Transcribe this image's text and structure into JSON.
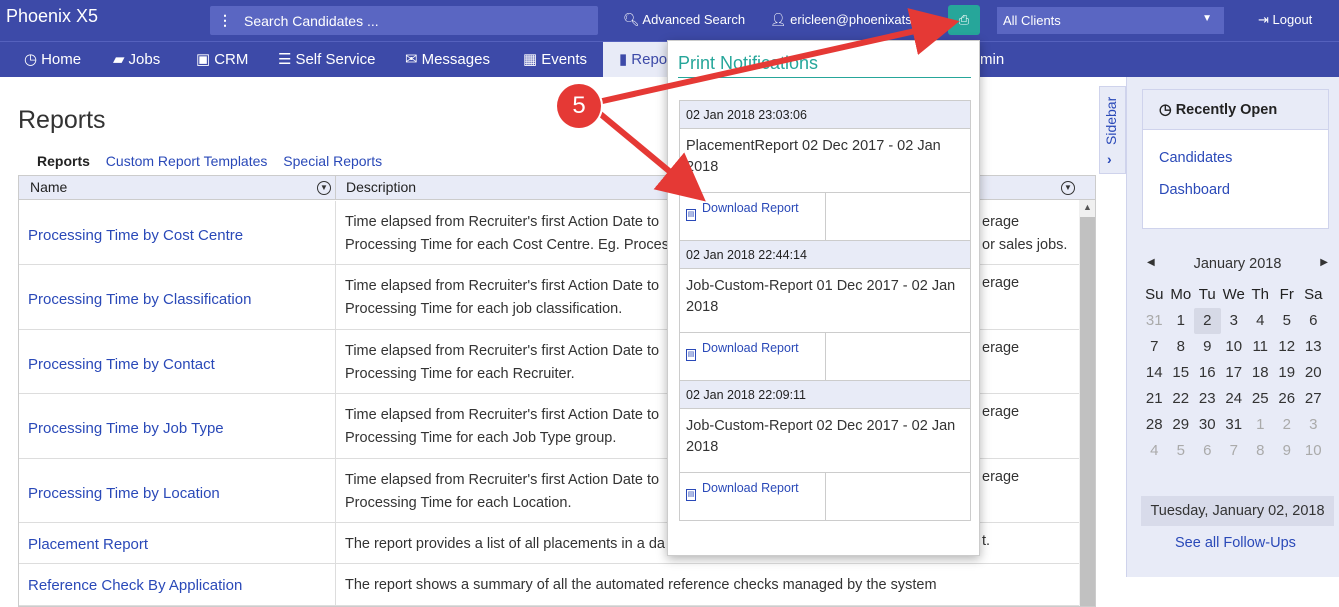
{
  "app": {
    "brand": "Phoenix X5",
    "search_placeholder": "Search Candidates ...",
    "advanced_search": "Advanced Search",
    "user": "ericleen@phoenixats.com",
    "client_select": "All Clients",
    "logout": "Logout",
    "print_icon": "print-icon"
  },
  "nav": [
    {
      "label": "Home",
      "icon": "home-icon"
    },
    {
      "label": "Jobs",
      "icon": "folder-icon"
    },
    {
      "label": "CRM",
      "icon": "briefcase-icon"
    },
    {
      "label": "Self Service",
      "icon": "list-icon"
    },
    {
      "label": "Messages",
      "icon": "envelope-icon"
    },
    {
      "label": "Events",
      "icon": "calendar-icon"
    },
    {
      "label": "Repo",
      "icon": "book-icon"
    },
    {
      "label": "min",
      "icon": ""
    }
  ],
  "reports": {
    "title": "Reports",
    "subtabs": [
      "Reports",
      "Custom Report Templates",
      "Special Reports"
    ],
    "columns": [
      "Name",
      "Description"
    ],
    "rows": [
      {
        "name": "Processing Time by Cost Centre",
        "desc1": "Time elapsed from Recruiter's first Action Date to",
        "desc2": "Processing Time for each Cost Centre. Eg. Proces",
        "tail1": "erage",
        "tail2": "or sales jobs."
      },
      {
        "name": "Processing Time by Classification",
        "desc1": "Time elapsed from Recruiter's first Action Date to",
        "desc2": "Processing Time for each job classification.",
        "tail1": "erage",
        "tail2": ""
      },
      {
        "name": "Processing Time by Contact",
        "desc1": "Time elapsed from Recruiter's first Action Date to",
        "desc2": "Processing Time for each Recruiter.",
        "tail1": "erage",
        "tail2": ""
      },
      {
        "name": "Processing Time by Job Type",
        "desc1": "Time elapsed from Recruiter's first Action Date to",
        "desc2": "Processing Time for each Job Type group.",
        "tail1": "erage",
        "tail2": ""
      },
      {
        "name": "Processing Time by Location",
        "desc1": "Time elapsed from Recruiter's first Action Date to",
        "desc2": "Processing Time for each Location.",
        "tail1": "erage",
        "tail2": ""
      },
      {
        "name": "Placement Report",
        "desc1": "The report provides a list of all placements in a da",
        "desc2": "",
        "tail1": "t.",
        "tail2": ""
      },
      {
        "name": "Reference Check By Application",
        "desc1": "The report shows a summary of all the automated reference checks managed by the system",
        "desc2": "",
        "tail1": "",
        "tail2": ""
      }
    ]
  },
  "sidebar": {
    "tab_label": "Sidebar",
    "recent_title": "Recently Open",
    "recent_links": [
      "Candidates",
      "Dashboard"
    ],
    "calendar": {
      "month": "January 2018",
      "dow": [
        "Su",
        "Mo",
        "Tu",
        "We",
        "Th",
        "Fr",
        "Sa"
      ],
      "weeks": [
        [
          "31",
          "1",
          "2",
          "3",
          "4",
          "5",
          "6"
        ],
        [
          "7",
          "8",
          "9",
          "10",
          "11",
          "12",
          "13"
        ],
        [
          "14",
          "15",
          "16",
          "17",
          "18",
          "19",
          "20"
        ],
        [
          "21",
          "22",
          "23",
          "24",
          "25",
          "26",
          "27"
        ],
        [
          "28",
          "29",
          "30",
          "31",
          "1",
          "2",
          "3"
        ],
        [
          "4",
          "5",
          "6",
          "7",
          "8",
          "9",
          "10"
        ]
      ],
      "footer": "Tuesday, January 02, 2018"
    },
    "see_all": "See all Follow-Ups"
  },
  "print_notifications": {
    "title": "Print Notifications",
    "items": [
      {
        "date": "02 Jan 2018 23:03:06",
        "title": "PlacementReport 02 Dec 2017 - 02 Jan 2018",
        "action": "Download Report"
      },
      {
        "date": "02 Jan 2018 22:44:14",
        "title": "Job-Custom-Report 01 Dec 2017 - 02 Jan 2018",
        "action": "Download Report"
      },
      {
        "date": "02 Jan 2018 22:09:11",
        "title": "Job-Custom-Report 02 Dec 2017 - 02 Jan 2018",
        "action": "Download Report"
      }
    ]
  },
  "annotation": {
    "step": "5",
    "color": "#e53935"
  }
}
